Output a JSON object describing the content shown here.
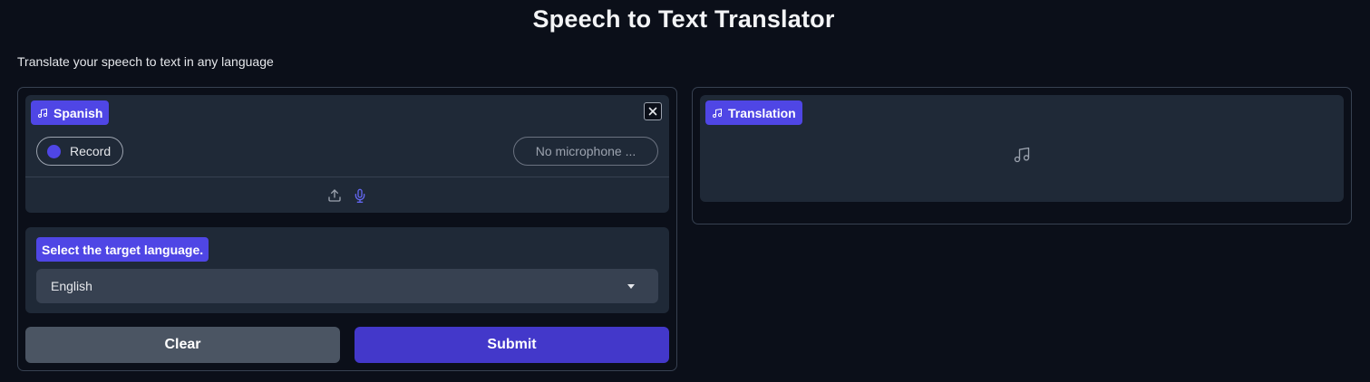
{
  "header": {
    "title": "Speech to Text Translator",
    "description": "Translate your speech to text in any language"
  },
  "input_audio": {
    "label": "Spanish",
    "label_icon": "music-note-icon",
    "record_label": "Record",
    "microphone_placeholder": "No microphone ...",
    "sources": [
      "upload-icon",
      "microphone-icon"
    ]
  },
  "target_language": {
    "label": "Select the target language.",
    "selected": "English"
  },
  "actions": {
    "clear_label": "Clear",
    "submit_label": "Submit"
  },
  "output_audio": {
    "label": "Translation",
    "label_icon": "music-note-icon",
    "empty_icon": "music-note-icon"
  },
  "colors": {
    "background": "#0b0f19",
    "block": "#1f2937",
    "accent": "#4f46e5",
    "submit": "#4338ca",
    "clear": "#4b5563"
  }
}
